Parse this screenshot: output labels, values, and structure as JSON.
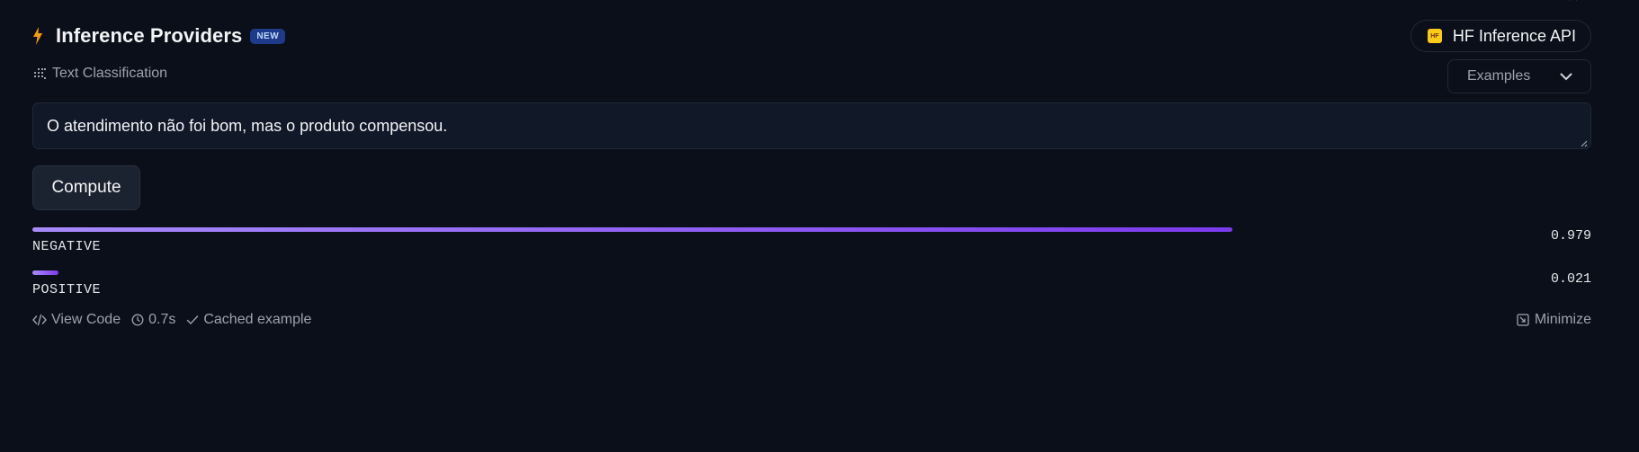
{
  "header": {
    "title": "Inference Providers",
    "badge": "NEW",
    "provider_logo_text": "HF",
    "provider_label": "HF Inference API"
  },
  "task": {
    "label": "Text Classification",
    "examples_label": "Examples"
  },
  "input": {
    "value": "O atendimento não foi bom, mas o produto compensou."
  },
  "compute_label": "Compute",
  "results": [
    {
      "label": "NEGATIVE",
      "score_text": "0.979",
      "score": 0.979
    },
    {
      "label": "POSITIVE",
      "score_text": "0.021",
      "score": 0.021
    }
  ],
  "footer": {
    "view_code": "View Code",
    "time": "0.7s",
    "cached": "Cached example",
    "minimize": "Minimize"
  },
  "colors": {
    "background": "#0b0f19",
    "accent_bolt": "#f59e0b",
    "bar_start": "#a78bfa",
    "bar_end": "#7c3aed",
    "badge_bg": "#1e3a8a"
  }
}
